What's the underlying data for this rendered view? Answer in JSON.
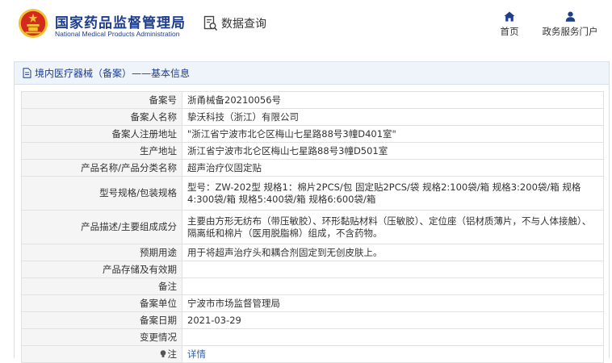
{
  "header": {
    "brand_cn": "国家药品监督管理局",
    "brand_en": "National Medical Products Administration",
    "query_label": "数据查询",
    "nav": [
      {
        "label": "首页",
        "icon": "home-icon"
      },
      {
        "label": "政务服务门户",
        "icon": "user-icon"
      }
    ]
  },
  "colors": {
    "brand": "#1d3d8f",
    "emblem_red": "#d22a1c",
    "emblem_gold": "#f2c230"
  },
  "panel": {
    "title": "境内医疗器械（备案）——基本信息"
  },
  "rows": [
    {
      "label": "备案号",
      "value": "浙甬械备20210056号"
    },
    {
      "label": "备案人名称",
      "value": "挚沃科技（浙江）有限公司"
    },
    {
      "label": "备案人注册地址",
      "value": "\"浙江省宁波市北仑区梅山七星路88号3幢D401室\""
    },
    {
      "label": "生产地址",
      "value": "浙江省宁波市北仑区梅山七星路88号3幢D501室"
    },
    {
      "label": "产品名称/产品分类名称",
      "value": "超声治疗仪固定贴"
    },
    {
      "label": "型号规格/包装规格",
      "value": "型号：ZW-202型 规格1：棉片2PCS/包 固定贴2PCS/袋 规格2:100袋/箱 规格3:200袋/箱 规格4:300袋/箱 规格5:400袋/箱 规格6:600袋/箱"
    },
    {
      "label": "产品描述/主要组成成分",
      "value": "主要由方形无纺布（带压敏胶）、环形黏贴材料（压敏胶）、定位座（铝材质薄片，不与人体接触）、隔离纸和棉片（医用脱脂棉）组成，不含药物。"
    },
    {
      "label": "预期用途",
      "value": "用于将超声治疗头和耦合剂固定到无创皮肤上。"
    },
    {
      "label": "产品存储及有效期",
      "value": ""
    },
    {
      "label": "备注",
      "value": ""
    },
    {
      "label": "备案单位",
      "value": "宁波市市场监督管理局"
    },
    {
      "label": "备案日期",
      "value": "2021-03-29"
    },
    {
      "label": "变更情况",
      "value": ""
    },
    {
      "label": "注",
      "value": "详情",
      "icon": "bulb-icon"
    }
  ]
}
